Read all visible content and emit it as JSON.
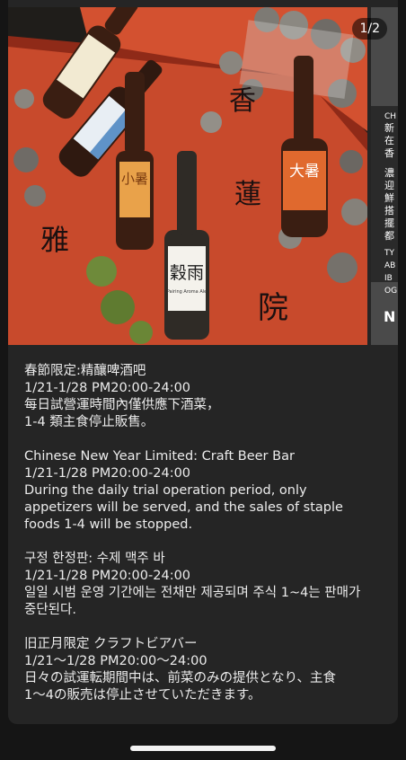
{
  "carousel": {
    "counter": "1/2",
    "image_text": {
      "bottle_chars": [
        "小暑",
        "穀雨",
        "大暑"
      ],
      "bottle_label_small": "Pairing Aroma Ale",
      "banner_chars": [
        "香",
        "蓮",
        "院",
        "雅"
      ],
      "next_slide_chars": [
        "CH",
        "新",
        "在",
        "香",
        "濃",
        "迎",
        "鮮",
        "搭",
        "擺",
        "都",
        "TY",
        "AB",
        "IB",
        "OG",
        "N"
      ]
    }
  },
  "post": {
    "paragraphs": [
      {
        "lines": [
          "春節限定:精釀啤酒吧",
          "1/21-1/28 PM20:00-24:00",
          "每日試營運時間內僅供應下酒菜，",
          "1-4 類主食停止販售。"
        ]
      },
      {
        "lines": [
          "Chinese New Year Limited: Craft Beer Bar",
          "1/21-1/28 PM20:00-24:00",
          "During the daily trial operation period, only",
          "appetizers will be served, and the sales of staple",
          "foods 1-4 will be stopped."
        ]
      },
      {
        "lines": [
          "구정 한정판: 수제 맥주 바",
          "1/21-1/28 PM20:00-24:00",
          "일일 시범 운영 기간에는 전채만 제공되며 주식 1~4는 판매가",
          "중단된다."
        ]
      },
      {
        "lines": [
          "旧正月限定 クラフトビアバー",
          "1/21～1/28 PM20:00～24:00",
          "日々の試運転期間中は、前菜のみの提供となり、主食",
          "1～4の販売は停止させていただきます。"
        ]
      }
    ]
  }
}
